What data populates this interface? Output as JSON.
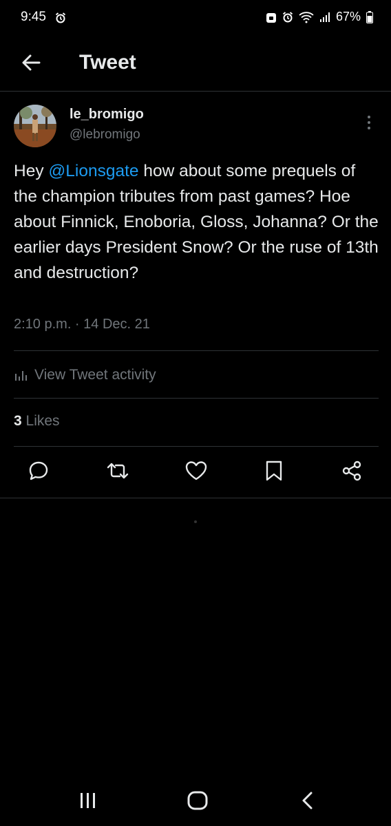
{
  "status_bar": {
    "time": "9:45",
    "battery": "67%"
  },
  "header": {
    "title": "Tweet"
  },
  "tweet": {
    "display_name": "le_bromigo",
    "handle": "@lebromigo",
    "text_before": "Hey ",
    "mention": "@Lionsgate",
    "text_after": " how about some prequels of the champion tributes from past games? Hoe about Finnick, Enoboria, Gloss, Johanna? Or the earlier days President Snow? Or the ruse of 13th and destruction?",
    "timestamp": "2:10 p.m. · 14 Dec. 21"
  },
  "activity": {
    "label": "View Tweet activity"
  },
  "stats": {
    "likes_count": "3",
    "likes_label": "Likes"
  },
  "colors": {
    "accent": "#1d9bf0",
    "muted": "#71767b",
    "text": "#e7e9ea",
    "divider": "#2f3336"
  }
}
